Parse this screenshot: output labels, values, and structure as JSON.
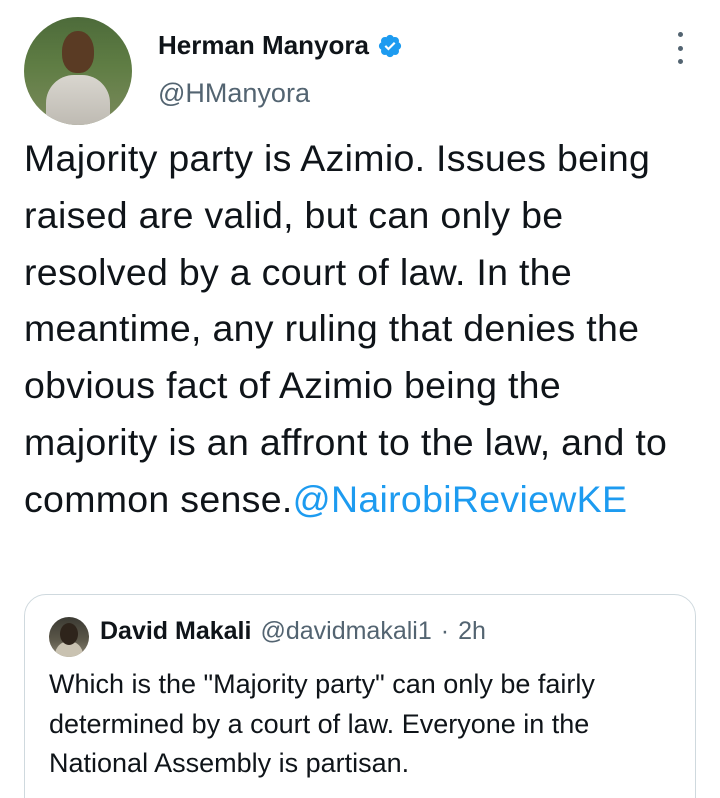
{
  "author": {
    "name": "Herman Manyora",
    "handle": "@HManyora"
  },
  "icons": {
    "verified": "verified-badge-icon",
    "more": "more-options-icon"
  },
  "colors": {
    "link": "#1d9bf0",
    "text": "#0f1419",
    "secondary": "#536471",
    "border": "#cfd9de"
  },
  "tweet": {
    "body": "Majority party is Azimio. Issues being raised are valid, but can only be resolved by a court of law. In the meantime, any ruling that denies the obvious fact of Azimio being the majority is an affront to the law, and to common sense.",
    "mention": "@NairobiReviewKE"
  },
  "quoted_tweet": {
    "name": "David Makali",
    "handle": "@davidmakali1",
    "separator": "·",
    "time": "2h",
    "text": "Which is the \"Majority party\" can only be fairly determined by a court of law. Everyone in the National Assembly is partisan."
  }
}
